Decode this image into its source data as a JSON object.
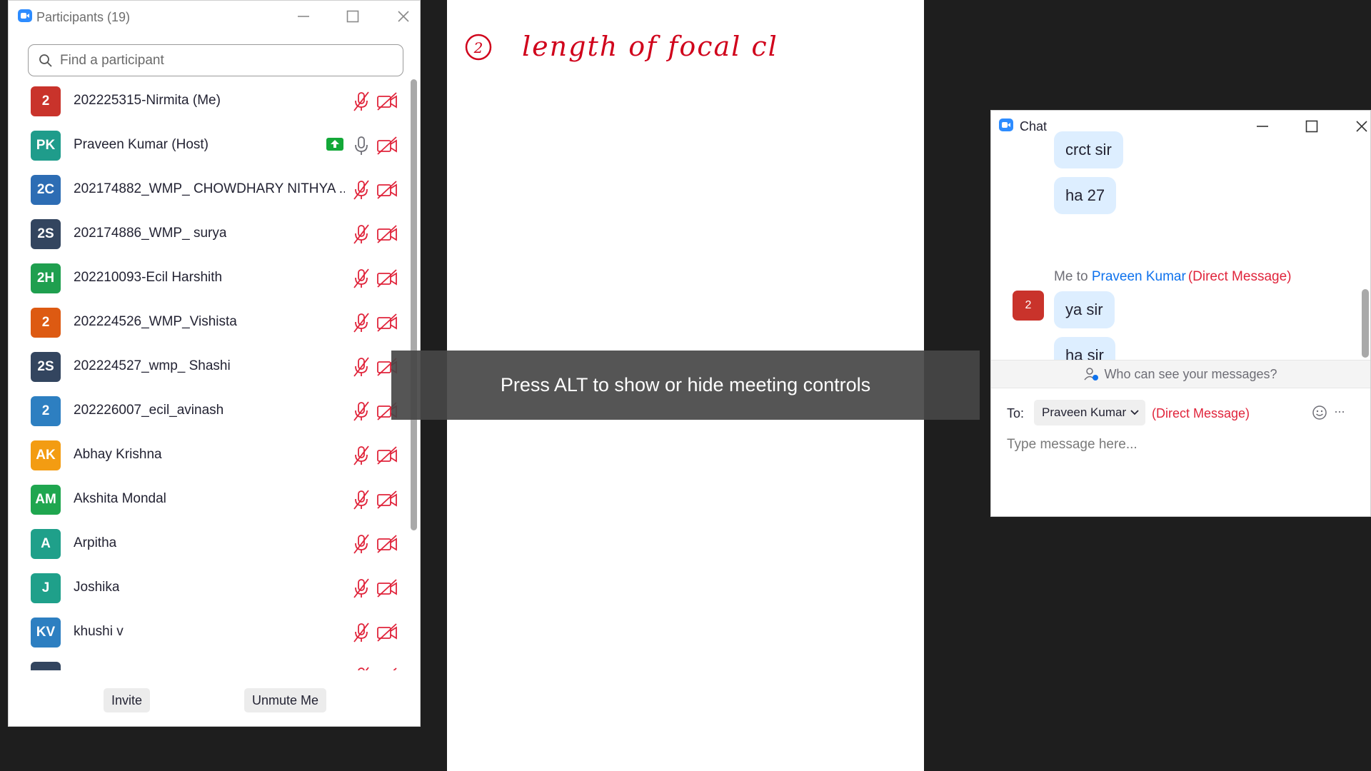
{
  "whiteboard": {
    "handwritten_text": "length of focal cl",
    "circled_number": "2"
  },
  "participants": {
    "title": "Participants (19)",
    "search_placeholder": "Find a participant",
    "list": [
      {
        "initials": "2",
        "name": "202225315-Nirmita (Me)",
        "color": "#c9332b",
        "mic": "muted",
        "video": "off",
        "sharing": false
      },
      {
        "initials": "PK",
        "name": "Praveen Kumar (Host)",
        "color": "#1f9c8b",
        "mic": "on",
        "video": "off",
        "sharing": true
      },
      {
        "initials": "2C",
        "name": "202174882_WMP_ CHOWDHARY NITHYA ...",
        "color": "#2d6db4",
        "mic": "muted",
        "video": "off",
        "sharing": false
      },
      {
        "initials": "2S",
        "name": "202174886_WMP_ surya",
        "color": "#33455f",
        "mic": "muted",
        "video": "off",
        "sharing": false
      },
      {
        "initials": "2H",
        "name": "202210093-Ecil Harshith",
        "color": "#1f9f4f",
        "mic": "muted",
        "video": "off",
        "sharing": false
      },
      {
        "initials": "2",
        "name": "202224526_WMP_Vishista",
        "color": "#dd5a12",
        "mic": "muted",
        "video": "off",
        "sharing": false
      },
      {
        "initials": "2S",
        "name": "202224527_wmp_ Shashi",
        "color": "#33455f",
        "mic": "muted",
        "video": "off",
        "sharing": false
      },
      {
        "initials": "2",
        "name": "202226007_ecil_avinash",
        "color": "#2d7fc1",
        "mic": "muted",
        "video": "off",
        "sharing": false
      },
      {
        "initials": "AK",
        "name": "Abhay Krishna",
        "color": "#f39c12",
        "mic": "muted",
        "video": "off",
        "sharing": false
      },
      {
        "initials": "AM",
        "name": "Akshita Mondal",
        "color": "#1fa64f",
        "mic": "muted",
        "video": "off",
        "sharing": false
      },
      {
        "initials": "A",
        "name": "Arpitha",
        "color": "#1fa08a",
        "mic": "muted",
        "video": "off",
        "sharing": false
      },
      {
        "initials": "J",
        "name": "Joshika",
        "color": "#1fa08a",
        "mic": "muted",
        "video": "off",
        "sharing": false
      },
      {
        "initials": "KV",
        "name": "khushi v",
        "color": "#2d7fc1",
        "mic": "muted",
        "video": "off",
        "sharing": false
      },
      {
        "initials": "",
        "name": "",
        "color": "#33455f",
        "mic": "muted",
        "video": "off",
        "sharing": false
      }
    ],
    "invite_label": "Invite",
    "unmute_label": "Unmute Me"
  },
  "toast": {
    "text": "Press ALT to show or hide meeting controls"
  },
  "chat": {
    "title": "Chat",
    "messages_top": [
      "crct sir",
      "ha 27"
    ],
    "sender_prefix": "Me to ",
    "recipient_name": "Praveen Kumar",
    "dm_tag": "(Direct Message)",
    "avatar_initial": "2",
    "my_messages": [
      "ya sir",
      "ha sir"
    ],
    "visibility_note": "Who can see your messages?",
    "to_label": "To:",
    "to_value": "Praveen Kumar",
    "to_dm_tag": "(Direct Message)",
    "input_placeholder": "Type message here...",
    "more_label": "···"
  },
  "colors": {
    "accent": "#2d8cff",
    "muted_red": "#e0243b",
    "dm_red": "#e0243b",
    "link_blue": "#0e72ed",
    "bubble_bg": "#ddeeff"
  }
}
